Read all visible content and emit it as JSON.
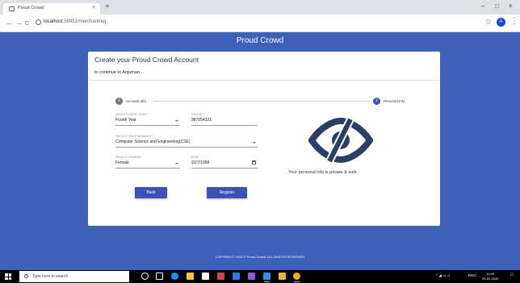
{
  "browser": {
    "tab_title": "Proud Crowd",
    "tab_close": "×",
    "new_tab": "+",
    "window_controls": [
      "–",
      "□",
      "×"
    ],
    "nav": {
      "back": "←",
      "forward": "→",
      "reload": "C"
    },
    "url_host": "localhost",
    "url_path": ":58951/merchantreg",
    "star": "☆",
    "profile_initial": "A",
    "menu": "⋮"
  },
  "brand": "Proud Crowd",
  "card": {
    "title": "Create your Proud Crowd Account",
    "subtitle": "to continue to Anjuman"
  },
  "stepper": {
    "steps": [
      {
        "number": "1",
        "label": "Account Info"
      },
      {
        "number": "2",
        "label": "Personal Info"
      }
    ]
  },
  "form": {
    "year": {
      "label": "SELECT YOUR YEAR *",
      "value": "Fourth Year"
    },
    "phone": {
      "label": "PHONE *",
      "value": "987654321"
    },
    "branch": {
      "label": "SELECT YOUR BRANCH *",
      "value": "Computer Science and Engineering(CSE)"
    },
    "gender": {
      "label": "SELECT GENDER",
      "value": "Female"
    },
    "dob": {
      "label": "DOB *",
      "value": "2/27/1998"
    }
  },
  "buttons": {
    "back": "Back",
    "register": "Register"
  },
  "privacy_text": "Your personal info is private & safe",
  "footer": "COPYRIGHT 2019 © Proud Crowd. ALL RIGHTS RESERVED",
  "taskbar": {
    "search_placeholder": "Type here to search",
    "tray_text": "ENG",
    "time": "10:49",
    "date": "29-02-2020"
  },
  "colors": {
    "page_bg": "#3f5fb8",
    "accent": "#3f51b5",
    "eye_icon": "#2c3e63"
  },
  "icons": [
    "search-icon",
    "eye-off-icon",
    "calendar-icon",
    "chevron-down-icon",
    "windows-icon"
  ]
}
